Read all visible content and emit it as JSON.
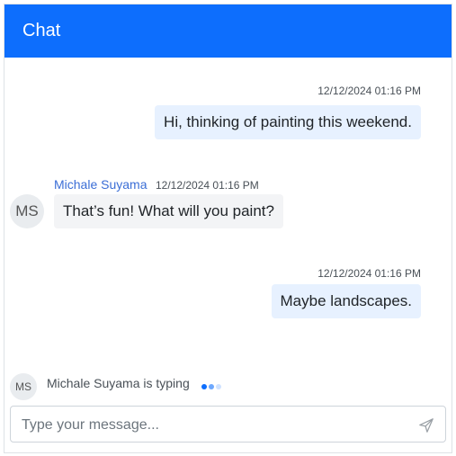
{
  "header": {
    "title": "Chat"
  },
  "messages": [
    {
      "direction": "out",
      "time": "12/12/2024 01:16 PM",
      "text": "Hi, thinking of painting this weekend."
    },
    {
      "direction": "in",
      "sender": "Michale Suyama",
      "avatar": "MS",
      "time": "12/12/2024 01:16 PM",
      "text": "That’s fun! What will you paint?"
    },
    {
      "direction": "out",
      "time": "12/12/2024 01:16 PM",
      "text": "Maybe landscapes."
    }
  ],
  "typing": {
    "avatar": "MS",
    "text": "Michale Suyama is typing"
  },
  "composer": {
    "placeholder": "Type your message...",
    "send_icon": "send-icon"
  },
  "colors": {
    "header": "#0d6efd",
    "outgoing_bubble": "#e7f1ff",
    "incoming_bubble": "#f3f4f6",
    "sender": "#3b6ed6"
  }
}
